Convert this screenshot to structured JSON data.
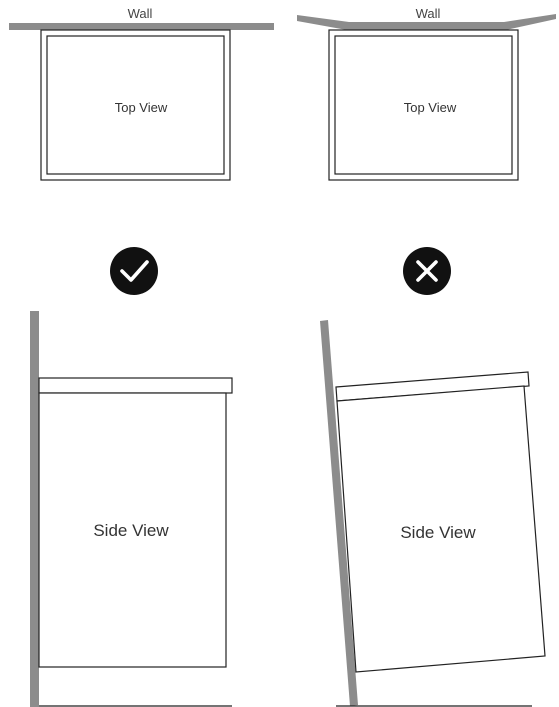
{
  "panels": {
    "correct": {
      "wall_label": "Wall",
      "top_view_label": "Top View",
      "side_view_label": "Side View",
      "status_icon": "checkmark-icon"
    },
    "incorrect": {
      "wall_label": "Wall",
      "top_view_label": "Top View",
      "side_view_label": "Side View",
      "status_icon": "x-mark-icon"
    }
  },
  "colors": {
    "wall": "#8c8c8c",
    "outline": "#222222",
    "icon_background": "#111111",
    "icon_glyph": "#ffffff",
    "text": "#333333"
  }
}
